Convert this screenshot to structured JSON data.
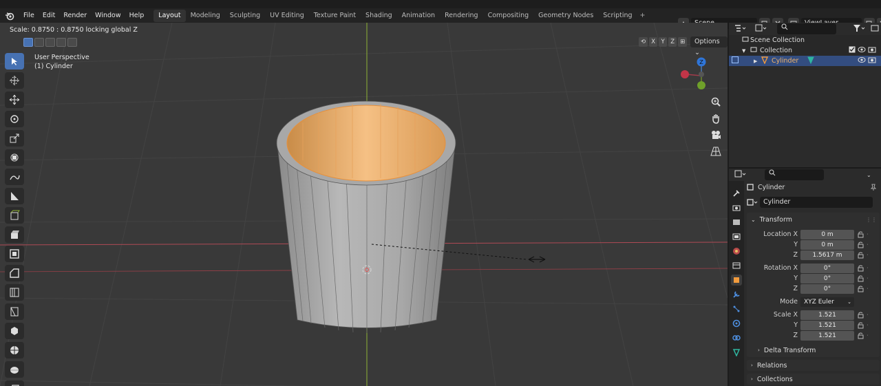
{
  "menus": [
    "File",
    "Edit",
    "Render",
    "Window",
    "Help"
  ],
  "workspaces": [
    "Layout",
    "Modeling",
    "Sculpting",
    "UV Editing",
    "Texture Paint",
    "Shading",
    "Animation",
    "Rendering",
    "Compositing",
    "Geometry Nodes",
    "Scripting"
  ],
  "active_workspace": "Layout",
  "scene_name": "Scene",
  "view_layer": "ViewLayer",
  "viewport": {
    "status": "Scale: 0.8750 : 0.8750 locking global Z",
    "perspective": "User Perspective",
    "object_label": "(1) Cylinder",
    "axis_x": "X",
    "axis_y": "Y",
    "axis_z": "Z",
    "options": "Options"
  },
  "gizmo": {
    "z": "Z"
  },
  "outliner": {
    "scene_collection": "Scene Collection",
    "collection": "Collection",
    "object": "Cylinder"
  },
  "properties": {
    "object_name": "Cylinder",
    "data_name": "Cylinder",
    "transform_header": "Transform",
    "location_label": "Location X",
    "rotation_label": "Rotation X",
    "scale_label": "Scale X",
    "y": "Y",
    "z": "Z",
    "location": [
      "0 m",
      "0 m",
      "1.5617 m"
    ],
    "rotation": [
      "0°",
      "0°",
      "0°"
    ],
    "mode_label": "Mode",
    "mode": "XYZ Euler",
    "scale": [
      "1.521",
      "1.521",
      "1.521"
    ],
    "delta": "Delta Transform",
    "relations": "Relations",
    "collections": "Collections"
  },
  "colors": {
    "accent": "#4772b3",
    "orange": "#f29b3d",
    "selected_row": "#334d80"
  }
}
